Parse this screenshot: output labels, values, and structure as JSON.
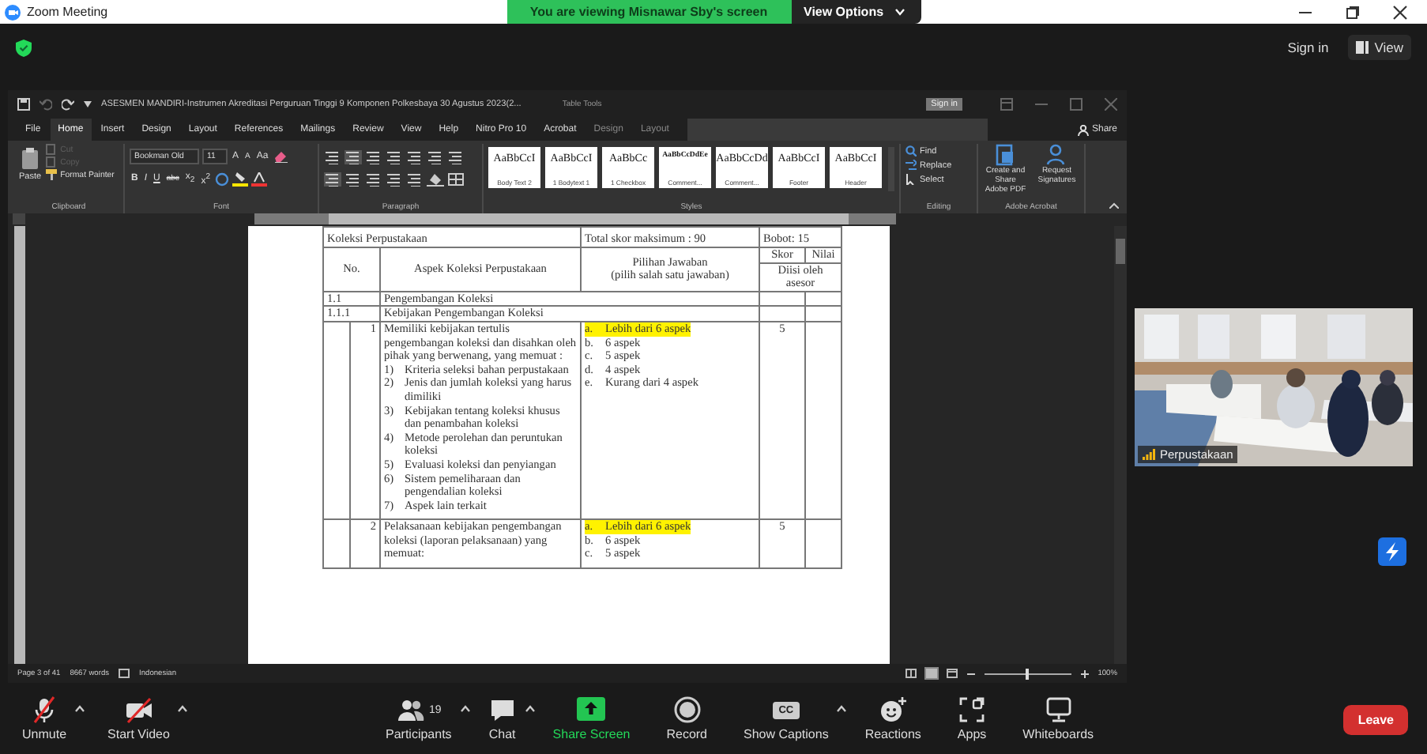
{
  "window": {
    "title": "Zoom Meeting"
  },
  "banner": {
    "message": "You are viewing Misnawar Sby's screen",
    "button": "View Options"
  },
  "header": {
    "sign_in": "Sign in",
    "view": "View"
  },
  "word": {
    "title": "ASESMEN MANDIRI-Instrumen Akreditasi Perguruan Tinggi 9 Komponen Polkesbaya 30 Agustus 2023(2...",
    "context": "Table Tools",
    "sign_in": "Sign in",
    "share": "Share",
    "tabs": [
      {
        "label": "File",
        "selected": false,
        "dimmed": false
      },
      {
        "label": "Home",
        "selected": true,
        "dimmed": false
      },
      {
        "label": "Insert",
        "selected": false,
        "dimmed": false
      },
      {
        "label": "Design",
        "selected": false,
        "dimmed": false
      },
      {
        "label": "Layout",
        "selected": false,
        "dimmed": false
      },
      {
        "label": "References",
        "selected": false,
        "dimmed": false
      },
      {
        "label": "Mailings",
        "selected": false,
        "dimmed": false
      },
      {
        "label": "Review",
        "selected": false,
        "dimmed": false
      },
      {
        "label": "View",
        "selected": false,
        "dimmed": false
      },
      {
        "label": "Help",
        "selected": false,
        "dimmed": false
      },
      {
        "label": "Nitro Pro 10",
        "selected": false,
        "dimmed": false
      },
      {
        "label": "Acrobat",
        "selected": false,
        "dimmed": false
      },
      {
        "label": "Design",
        "selected": false,
        "dimmed": true
      },
      {
        "label": "Layout",
        "selected": false,
        "dimmed": true
      }
    ],
    "clipboard": {
      "paste": "Paste",
      "items": [
        {
          "label": "Cut",
          "disabled": true
        },
        {
          "label": "Copy",
          "disabled": true
        },
        {
          "label": "Format Painter",
          "disabled": false
        }
      ],
      "label": "Clipboard"
    },
    "font": {
      "name": "Bookman Old",
      "size": "11",
      "size_buttons": [
        "A",
        "A",
        "Aa"
      ],
      "format": [
        "B",
        "I",
        "U",
        "abc",
        "x$_{2}$",
        "x$^{2}$"
      ],
      "label": "Font"
    },
    "paragraph": {
      "label": "Paragraph"
    },
    "styles": {
      "items": [
        {
          "sample": "AaBbCcI",
          "name": "Body Text 2"
        },
        {
          "sample": "AaBbCcI",
          "name": "1 Bodytext 1"
        },
        {
          "sample": "AaBbCc",
          "name": "1 Checkbox"
        },
        {
          "sample": "AaBbCcDdEe",
          "name": "Comment..."
        },
        {
          "sample": "AaBbCcDd",
          "name": "Comment..."
        },
        {
          "sample": "AaBbCcI",
          "name": "Footer"
        },
        {
          "sample": "AaBbCcI",
          "name": "Header"
        }
      ],
      "label": "Styles"
    },
    "editing": {
      "items": [
        "Find",
        "Replace",
        "Select"
      ],
      "label": "Editing"
    },
    "acrobat": {
      "items": [
        "Create and Share Adobe PDF",
        "Request Signatures"
      ],
      "label": "Adobe Acrobat"
    },
    "document": {
      "caption": "Koleksi Perpustakaan",
      "total": "Total skor maksimum : 90",
      "weight": "Bobot: 15",
      "headers": {
        "number": "No.",
        "aspect": "Aspek Koleksi Perpustakaan",
        "answer": "Pilihan Jawaban",
        "answer_note": "(pilih salah satu jawaban)",
        "score": "Skor",
        "value": "Nilai",
        "assessor": "Diisi oleh asesor"
      },
      "sections": [
        {
          "number": "1.1",
          "title": "Pengembangan Koleksi"
        },
        {
          "number": "1.1.1",
          "title": "Kebijakan Pengembangan Koleksi"
        }
      ],
      "rows": [
        {
          "number": "1",
          "aspect": "Memiliki kebijakan tertulis pengembangan koleksi dan disahkan oleh pihak yang berwenang, yang memuat :",
          "items": [
            {
              "marker": "1)",
              "text": "Kriteria seleksi bahan perpustakaan"
            },
            {
              "marker": "2)",
              "text": "Jenis dan jumlah koleksi yang harus dimiliki"
            },
            {
              "marker": "3)",
              "text": "Kebijakan tentang koleksi khusus dan penambahan koleksi"
            },
            {
              "marker": "4)",
              "text": "Metode perolehan dan peruntukan koleksi"
            },
            {
              "marker": "5)",
              "text": "Evaluasi koleksi dan penyiangan"
            },
            {
              "marker": "6)",
              "text": "Sistem pemeliharaan dan pengendalian koleksi"
            },
            {
              "marker": "7)",
              "text": "Aspek lain terkait"
            }
          ],
          "options": [
            {
              "letter": "a.",
              "text": "Lebih dari 6 aspek",
              "highlighted": true
            },
            {
              "letter": "b.",
              "text": "6 aspek",
              "highlighted": false
            },
            {
              "letter": "c.",
              "text": "5 aspek",
              "highlighted": false
            },
            {
              "letter": "d.",
              "text": "4 aspek",
              "highlighted": false
            },
            {
              "letter": "e.",
              "text": "Kurang dari 4 aspek",
              "highlighted": false
            }
          ],
          "score": "5"
        },
        {
          "number": "2",
          "aspect": "Pelaksanaan kebijakan pengembangan koleksi (laporan pelaksanaan) yang memuat:",
          "items": [],
          "options": [
            {
              "letter": "a.",
              "text": "Lebih dari 6 aspek",
              "highlighted": true
            },
            {
              "letter": "b.",
              "text": "6 aspek",
              "highlighted": false
            },
            {
              "letter": "c.",
              "text": "5 aspek",
              "highlighted": false
            }
          ],
          "score": "5"
        }
      ]
    },
    "status_bar": {
      "page": "Page 3 of 41",
      "words": "8667 words",
      "language": "Indonesian",
      "zoom": "100%",
      "zoom_slider": {
        "level": 0.5
      }
    }
  },
  "video": {
    "participant": "Perpustakaan"
  },
  "toolbar": {
    "left": [
      {
        "label": "Unmute",
        "kind": "mic",
        "menu": true
      },
      {
        "label": "Start Video",
        "kind": "video",
        "menu": true
      }
    ],
    "center": [
      {
        "label": "Participants",
        "kind": "participants",
        "count": "19",
        "menu": true
      },
      {
        "label": "Chat",
        "kind": "chat",
        "menu": true
      },
      {
        "label": "Share Screen",
        "kind": "share",
        "menu": false
      },
      {
        "label": "Record",
        "kind": "record",
        "menu": false
      },
      {
        "label": "Show Captions",
        "kind": "captions",
        "badge": "CC",
        "menu": true
      },
      {
        "label": "Reactions",
        "kind": "reactions",
        "menu": false
      },
      {
        "label": "Apps",
        "kind": "apps",
        "menu": false
      },
      {
        "label": "Whiteboards",
        "kind": "whiteboard",
        "menu": false
      }
    ],
    "leave": "Leave"
  }
}
